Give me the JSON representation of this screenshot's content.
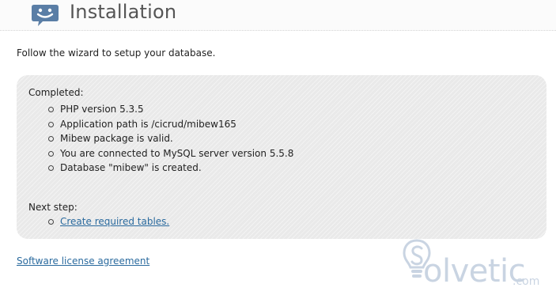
{
  "header": {
    "title": "Installation",
    "icon": "smiley-speech-bubble-icon"
  },
  "intro": {
    "text": "Follow the wizard to setup your database."
  },
  "status_panel": {
    "completed_label": "Completed:",
    "completed_items": [
      "PHP version 5.3.5",
      "Application path is /cicrud/mibew165",
      "Mibew package is valid.",
      "You are connected to MySQL server version 5.5.8",
      "Database \"mibew\" is created."
    ],
    "next_label": "Next step:",
    "next_items": [
      "Create required tables."
    ]
  },
  "footer": {
    "license_link": "Software license agreement"
  },
  "watermark": {
    "brand": "olvetic",
    "suffix": ".com"
  },
  "colors": {
    "link": "#2a6a9e",
    "panel_bg": "#e9e9e9",
    "icon": "#5a7ea6",
    "watermark": "#c9d4e2"
  }
}
